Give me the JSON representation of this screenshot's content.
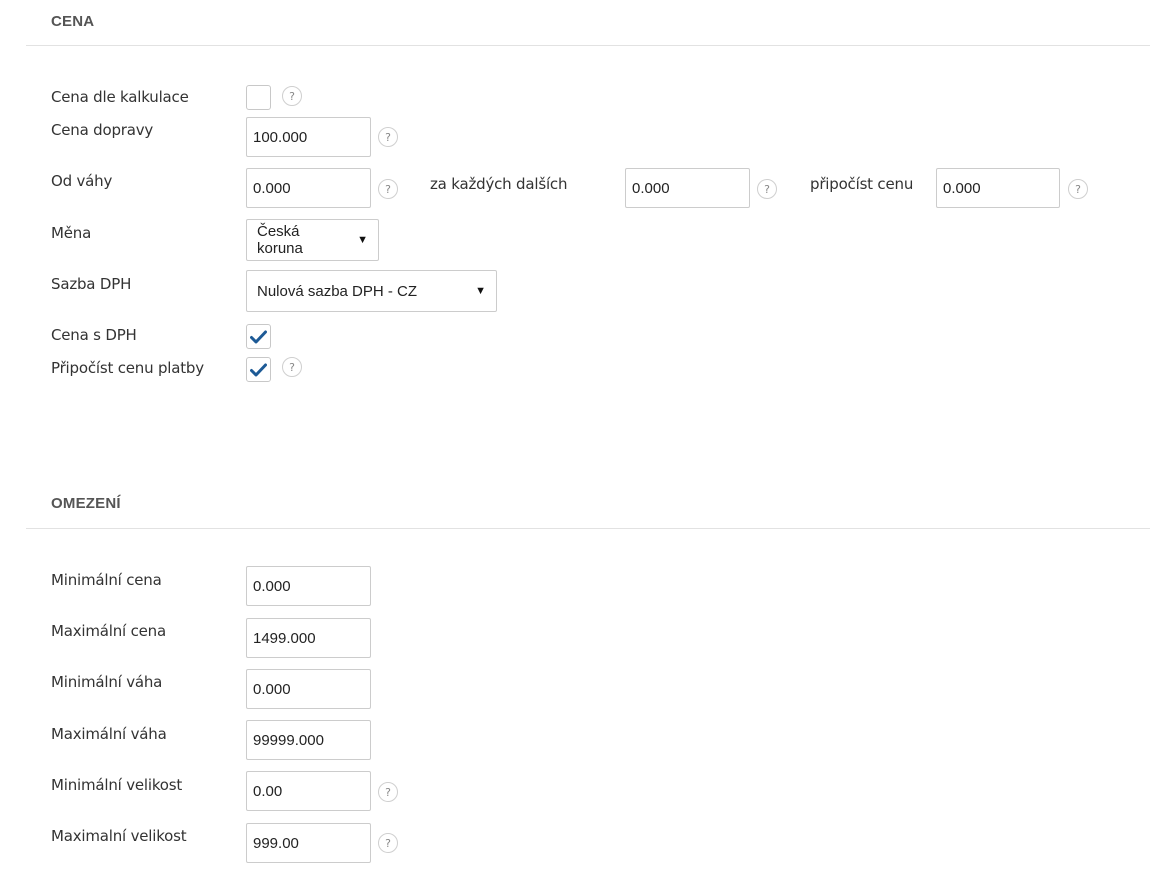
{
  "sections": {
    "price": {
      "title": "CENA"
    },
    "limits": {
      "title": "OMEZENÍ"
    }
  },
  "price": {
    "calc_label": "Cena dle kalkulace",
    "calc_checked": false,
    "shipping_label": "Cena dopravy",
    "shipping_value": "100.000",
    "from_weight_label": "Od váhy",
    "from_weight_value": "0.000",
    "every_next_label": "za každých dalších",
    "every_next_value": "0.000",
    "add_price_label": "připočíst cenu",
    "add_price_value": "0.000",
    "currency_label": "Měna",
    "currency_value": "Česká koruna",
    "vat_rate_label": "Sazba DPH",
    "vat_rate_value": "Nulová sazba DPH - CZ",
    "price_with_vat_label": "Cena s DPH",
    "price_with_vat_checked": true,
    "add_payment_price_label": "Připočíst cenu platby",
    "add_payment_price_checked": true
  },
  "limits": {
    "min_price_label": "Minimální cena",
    "min_price_value": "0.000",
    "max_price_label": "Maximální cena",
    "max_price_value": "1499.000",
    "min_weight_label": "Minimální váha",
    "min_weight_value": "0.000",
    "max_weight_label": "Maximální váha",
    "max_weight_value": "99999.000",
    "min_size_label": "Minimální velikost",
    "min_size_value": "0.00",
    "max_size_label": "Maximalní velikost",
    "max_size_value": "999.00"
  },
  "help": {
    "glyph": "?"
  },
  "icons": {
    "check": "checkmark-icon",
    "dropdown": "chevron-down-icon"
  },
  "colors": {
    "check": "#1d5a96",
    "divider": "#e2e2e2"
  }
}
